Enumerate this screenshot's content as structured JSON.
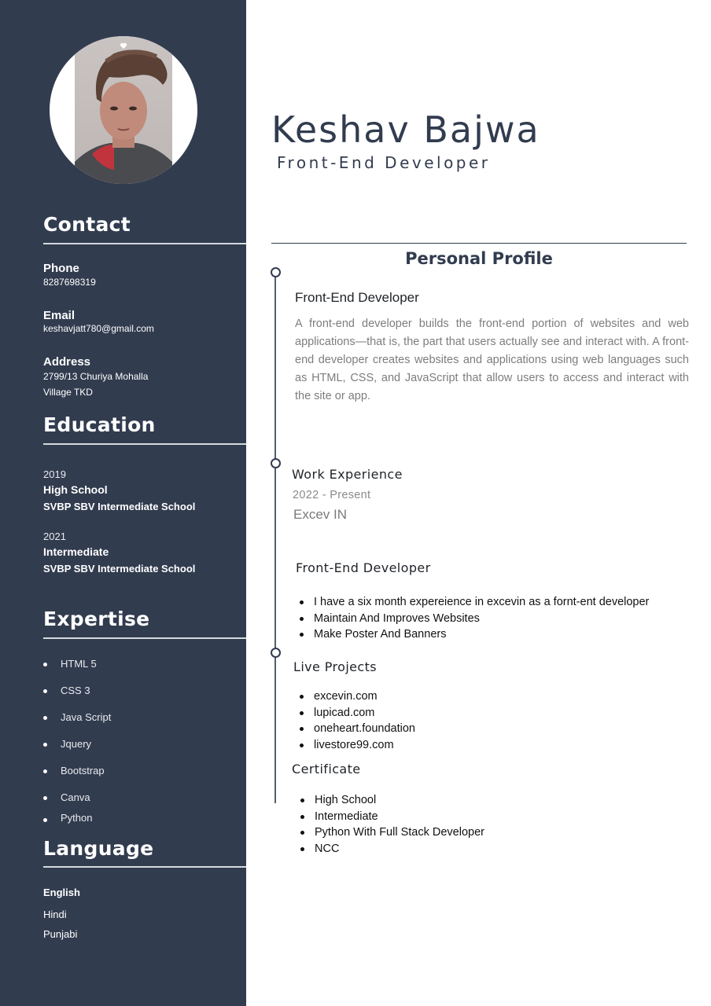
{
  "name": "Keshav Bajwa",
  "role": "Front-End Developer",
  "contact": {
    "title": "Contact",
    "phone_label": "Phone",
    "phone": "8287698319",
    "email_label": "Email",
    "email": "keshavjatt780@gmail.com",
    "address_label": "Address",
    "address_line1": "2799/13 Churiya Mohalla",
    "address_line2": "Village TKD"
  },
  "education": {
    "title": "Education",
    "items": [
      {
        "year": "2019",
        "level": "High School",
        "school": "SVBP SBV Intermediate School"
      },
      {
        "year": "2021",
        "level": "Intermediate",
        "school": "SVBP SBV Intermediate School"
      }
    ]
  },
  "expertise": {
    "title": "Expertise",
    "items": [
      "HTML 5",
      "CSS 3",
      "Java Script",
      "Jquery",
      "Bootstrap",
      "Canva",
      "Python"
    ]
  },
  "language": {
    "title": "Language",
    "items": [
      "English",
      "Hindi",
      "Punjabi"
    ]
  },
  "profile": {
    "title": "Personal Profile",
    "subtitle": "Front-End Developer",
    "text": "A front-end developer builds the front-end portion of websites and web applications—that is, the part that users actually see and interact with. A front-end developer creates websites and applications using web languages such as HTML, CSS, and JavaScript that allow users to access and interact with the site or app."
  },
  "work": {
    "title": "Work Experience",
    "period": "2022 - Present",
    "company": "Excev IN",
    "position": "Front-End Developer",
    "bullets": [
      "I have a six month expereience in excevin as a fornt-ent developer",
      "Maintain And Improves Websites",
      "Make Poster And Banners"
    ]
  },
  "projects": {
    "title": "Live Projects",
    "items": [
      "excevin.com",
      "lupicad.com",
      "oneheart.foundation",
      "livestore99.com"
    ]
  },
  "certificate": {
    "title": "Certificate",
    "items": [
      "High School",
      "Intermediate",
      "Python With Full Stack Developer",
      "NCC"
    ]
  },
  "colors": {
    "sidebar": "#323c4f",
    "accent": "#323c4f",
    "body_text": "#7d7d7d"
  }
}
